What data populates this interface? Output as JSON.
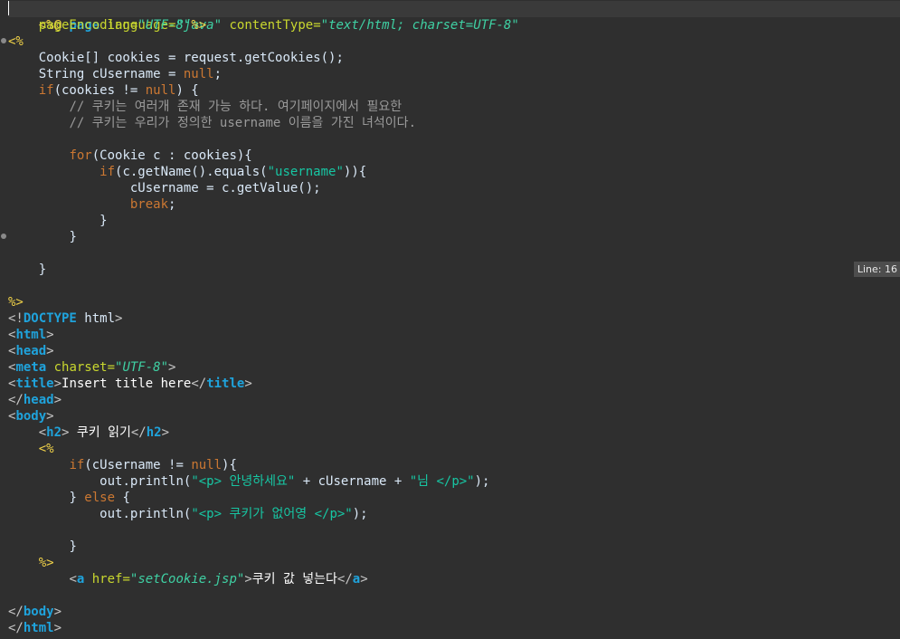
{
  "status": {
    "line_label": "Line: 16"
  },
  "code": {
    "l1": {
      "a": "<%@",
      "b": "page",
      "c": "language=",
      "d": "\"java\"",
      "e": "contentType=",
      "f": "\"text/html; charset=UTF-8\""
    },
    "l2": {
      "a": "pageEncoding=",
      "b": "\"UTF-8\"",
      "c": "%>"
    },
    "l3": {
      "a": "<%"
    },
    "l5": {
      "a": "Cookie[] cookies = request.getCookies();"
    },
    "l6": {
      "a": "String cUsername = ",
      "b": "null",
      "c": ";"
    },
    "l7": {
      "a": "if",
      "b": "(cookies != ",
      "c": "null",
      "d": ") {"
    },
    "l8": {
      "a": "// 쿠키는 여러개 존재 가능 하다. 여기페이지에서 필요한"
    },
    "l9": {
      "a": "// 쿠키는 우리가 정의한 username 이름을 가진 녀석이다."
    },
    "l11": {
      "a": "for",
      "b": "(Cookie c : cookies){"
    },
    "l12": {
      "a": "if",
      "b": "(c.getName().equals(",
      "c": "\"username\"",
      "d": ")){"
    },
    "l13": {
      "a": "cUsername = c.getValue();"
    },
    "l14": {
      "a": "break",
      "b": ";"
    },
    "l15": {
      "a": "}"
    },
    "l16": {
      "a": "}"
    },
    "l18": {
      "a": "}"
    },
    "l20": {
      "a": "%>"
    },
    "l21": {
      "a": "<!",
      "b": "DOCTYPE",
      "c": " html",
      "d": ">"
    },
    "l22": {
      "a": "html"
    },
    "l23": {
      "a": "head"
    },
    "l24": {
      "a": "meta",
      "b": " charset=",
      "c": "\"UTF-8\""
    },
    "l25": {
      "a": "title",
      "b": "Insert title here",
      "c": "title"
    },
    "l26": {
      "a": "head"
    },
    "l27": {
      "a": "body"
    },
    "l28": {
      "a": "h2",
      "b": " 쿠키 읽기",
      "c": "h2"
    },
    "l29": {
      "a": "<%"
    },
    "l30": {
      "a": "if",
      "b": "(cUsername != ",
      "c": "null",
      "d": "){"
    },
    "l31": {
      "a": "out.println(",
      "b": "\"<p> 안녕하세요\"",
      "c": " + cUsername + ",
      "d": "\"님 </p>\"",
      "e": ");"
    },
    "l32": {
      "a": "} ",
      "b": "else",
      "c": " {"
    },
    "l33": {
      "a": "out.println(",
      "b": "\"<p> 쿠키가 없어영 </p>\"",
      "c": ");"
    },
    "l35": {
      "a": "}"
    },
    "l36": {
      "a": "%>"
    },
    "l37": {
      "a": "a",
      "b": " href=",
      "c": "\"setCookie.jsp\"",
      "d": "쿠키 값 넣는다",
      "e": "a"
    },
    "l39": {
      "a": "body"
    },
    "l40": {
      "a": "html"
    }
  }
}
